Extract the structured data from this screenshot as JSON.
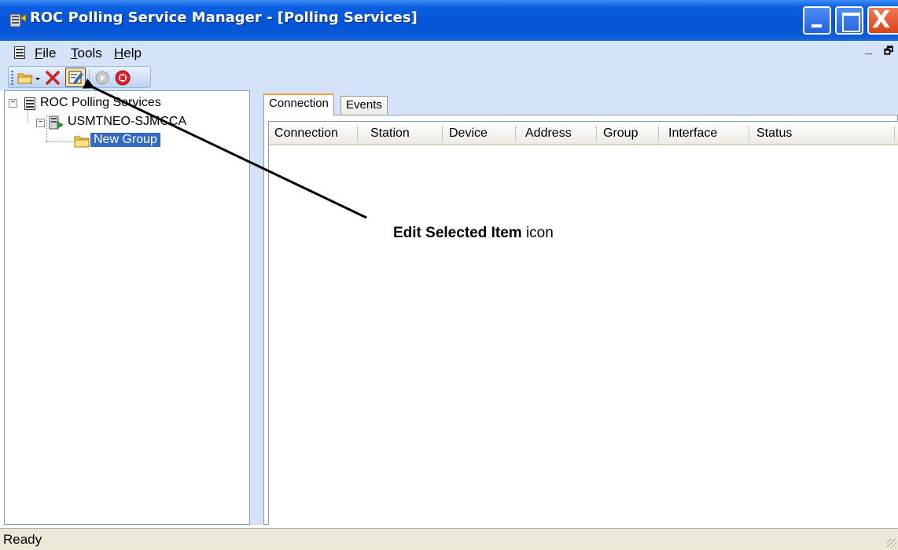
{
  "window": {
    "title": "ROC Polling Service Manager - [Polling Services]",
    "close_glyph": "X"
  },
  "menu": {
    "items": [
      {
        "label": "File",
        "mnemonic": "F",
        "rest": "ile"
      },
      {
        "label": "Tools",
        "mnemonic": "T",
        "rest": "ools"
      },
      {
        "label": "Help",
        "mnemonic": "H",
        "rest": "elp"
      }
    ],
    "mdi_minimize": "_",
    "mdi_restore": "🗗"
  },
  "toolbar": {
    "buttons": [
      {
        "name": "new-folder-dropdown-button",
        "icon": "open-folder-icon"
      },
      {
        "name": "delete-button",
        "icon": "red-x-icon"
      },
      {
        "name": "edit-selected-item-button",
        "icon": "edit-icon"
      },
      {
        "name": "start-button",
        "icon": "play-icon"
      },
      {
        "name": "stop-button",
        "icon": "stop-icon"
      }
    ]
  },
  "tree": {
    "root": {
      "label": "ROC Polling Services",
      "expander": "−"
    },
    "server": {
      "label": "USMTNEO-SJMCCA",
      "expander": "−"
    },
    "group": {
      "label": "New Group",
      "selected": true
    }
  },
  "tabs": [
    {
      "label": "Connection",
      "active": true
    },
    {
      "label": "Events",
      "active": false
    }
  ],
  "list": {
    "columns": [
      "Connection",
      "Station",
      "Device",
      "Address",
      "Group",
      "Interface",
      "Status"
    ],
    "rows": []
  },
  "status": {
    "text": "Ready"
  },
  "annotation": {
    "bold_text": "Edit Selected Item",
    "normal_text": " icon"
  },
  "colors": {
    "title_bar": "#0553d6",
    "menu_bg": "#d5e3f8",
    "selection": "#316ac5",
    "close_button": "#d9431c"
  }
}
